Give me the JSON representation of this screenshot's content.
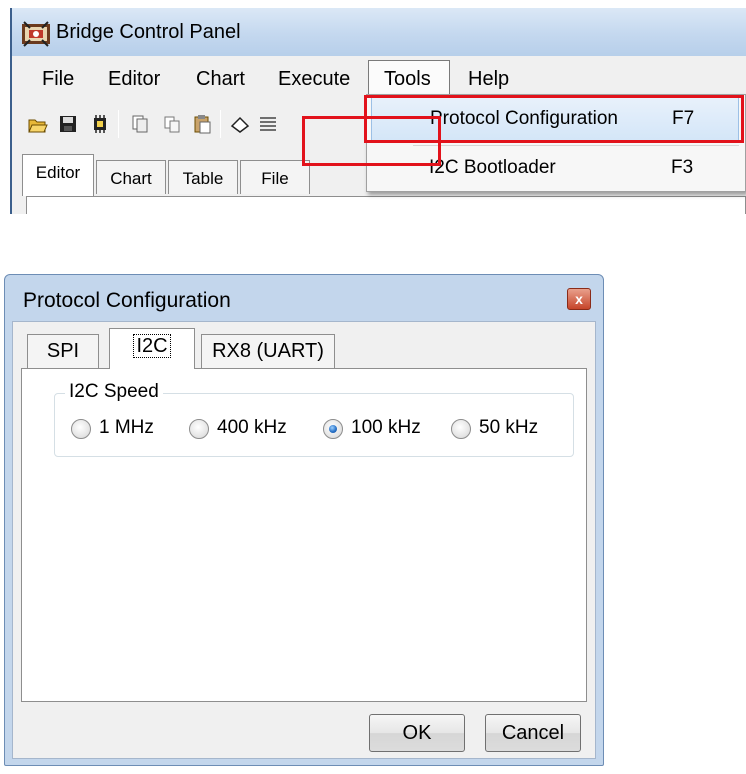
{
  "bridge_window": {
    "title": "Bridge Control Panel",
    "menu": [
      "File",
      "Editor",
      "Chart",
      "Execute",
      "Tools",
      "Help"
    ],
    "tabs": [
      "Editor",
      "Chart",
      "Table",
      "File"
    ],
    "toolbar_icons": [
      "open-folder-icon",
      "save-icon",
      "chip-icon",
      "copy-icon",
      "copy-icon",
      "paste-icon",
      "eraser-icon",
      "list-icon"
    ]
  },
  "tools_menu": {
    "items": [
      {
        "label": "Protocol Configuration",
        "shortcut": "F7",
        "highlighted": true
      },
      {
        "label": "I2C Bootloader",
        "shortcut": "F3"
      }
    ]
  },
  "dialog": {
    "title": "Protocol Configuration",
    "close_glyph": "x",
    "tabs": [
      "SPI",
      "I2C",
      "RX8 (UART)"
    ],
    "active_tab": "I2C",
    "speed_group_label": "I2C Speed",
    "speed_options": [
      {
        "label": "1 MHz",
        "selected": false
      },
      {
        "label": "400 kHz",
        "selected": false
      },
      {
        "label": "100 kHz",
        "selected": true
      },
      {
        "label": "50 kHz",
        "selected": false
      }
    ],
    "ok_label": "OK",
    "cancel_label": "Cancel"
  },
  "colors": {
    "highlight": "#e2121b",
    "titlebar": "#c4d8ef",
    "dialog_frame": "#c3d6ec"
  }
}
